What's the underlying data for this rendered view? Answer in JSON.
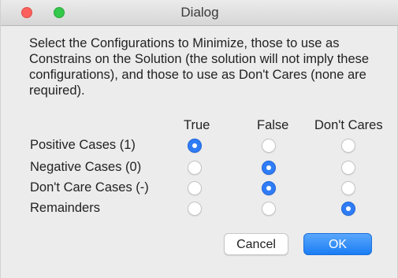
{
  "window": {
    "title": "Dialog",
    "colors": {
      "close": "#fc615d",
      "zoom": "#34c84a",
      "accent": "#2f7cf6"
    }
  },
  "description": "Select the Configurations to Minimize, those to use as Constrains on the Solution (the solution will not imply these configurations), and those to use as Don't Cares (none are required).",
  "columns": [
    "True",
    "False",
    "Don't Cares"
  ],
  "rows": [
    {
      "label": "Positive Cases (1)",
      "selected": "True"
    },
    {
      "label": "Negative Cases (0)",
      "selected": "False"
    },
    {
      "label": "Don't Care Cases (-)",
      "selected": "False"
    },
    {
      "label": "Remainders",
      "selected": "Don't Cares"
    }
  ],
  "buttons": {
    "cancel": "Cancel",
    "ok": "OK"
  }
}
